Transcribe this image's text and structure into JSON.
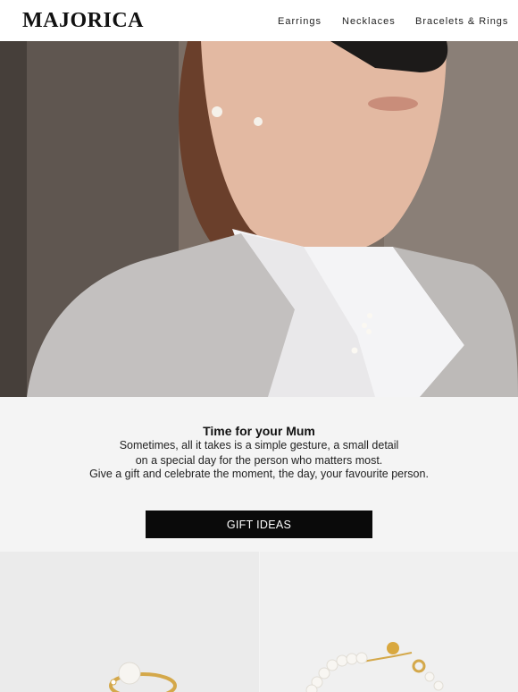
{
  "brand": {
    "logo_text": "MAJORICA"
  },
  "nav": {
    "items": [
      "Earrings",
      "Necklaces",
      "Bracelets & Rings"
    ]
  },
  "hero": {
    "image": "woman-in-grey-blazer-wearing-pearl-jewelry"
  },
  "promo": {
    "title": "Time for your Mum",
    "lines": [
      "Sometimes, all it takes is a simple gesture, a small detail",
      "on a special day for the person who matters most.",
      "Give a gift and celebrate the moment, the day, your favourite person."
    ],
    "cta_label": "GIFT IDEAS"
  },
  "products": [
    {
      "image": "gold-pearl-ring"
    },
    {
      "image": "gold-pearl-bracelet"
    }
  ],
  "colors": {
    "cta_bg": "#0a0a0a",
    "page_bg": "#f4f4f4",
    "header_bg": "#ffffff"
  }
}
